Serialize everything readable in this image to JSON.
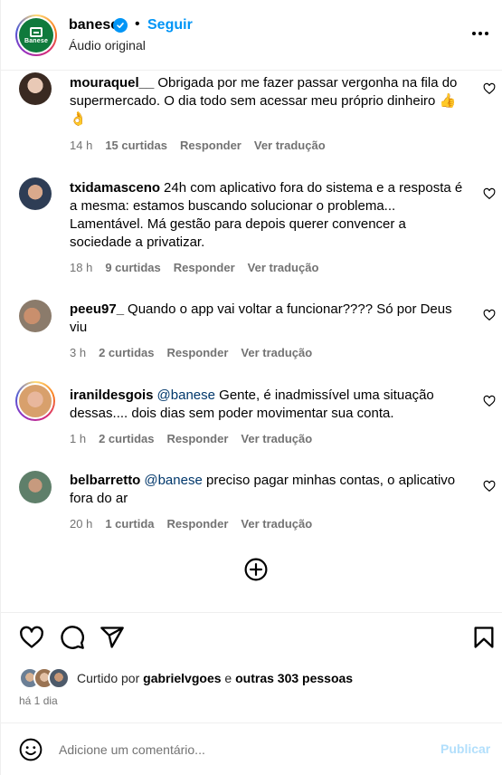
{
  "header": {
    "account": "banese",
    "logo_text": "Banese",
    "separator": "•",
    "follow_label": "Seguir",
    "audio_label": "Áudio original"
  },
  "comments": [
    {
      "username": "mouraquel__",
      "mention": "",
      "text": "Obrigada por me fazer passar vergonha na fila do supermercado. O dia todo sem acessar meu próprio dinheiro 👍 👌",
      "time": "14 h",
      "likes": "15 curtidas",
      "reply_label": "Responder",
      "translate_label": "Ver tradução"
    },
    {
      "username": "txidamasceno",
      "mention": "",
      "text": "24h com aplicativo fora do sistema e a resposta é a mesma: estamos buscando solucionar o problema... Lamentável. Má gestão para depois querer convencer a sociedade a privatizar.",
      "time": "18 h",
      "likes": "9 curtidas",
      "reply_label": "Responder",
      "translate_label": "Ver tradução"
    },
    {
      "username": "peeu97_",
      "mention": "",
      "text": "Quando o app vai voltar a funcionar???? Só por Deus viu",
      "time": "3 h",
      "likes": "2 curtidas",
      "reply_label": "Responder",
      "translate_label": "Ver tradução"
    },
    {
      "username": "iranildesgois",
      "mention": "@banese",
      "text": "Gente, é inadmissível uma situação dessas.... dois dias sem poder movimentar sua conta.",
      "time": "1 h",
      "likes": "2 curtidas",
      "reply_label": "Responder",
      "translate_label": "Ver tradução"
    },
    {
      "username": "belbarretto",
      "mention": "@banese",
      "text": "preciso pagar minhas contas, o aplicativo fora do ar",
      "time": "20 h",
      "likes": "1 curtida",
      "reply_label": "Responder",
      "translate_label": "Ver tradução"
    }
  ],
  "likes": {
    "prefix": "Curtido por",
    "user": "gabrielvgoes",
    "conjunction": "e",
    "others": "outras 303 pessoas"
  },
  "time_ago": "há 1 dia",
  "composer": {
    "placeholder": "Adicione um comentário...",
    "publish_label": "Publicar"
  },
  "icons": {
    "verified": "verified-badge-icon",
    "more": "more-options-icon",
    "like": "heart-icon",
    "comment": "comment-icon",
    "share": "share-icon",
    "save": "bookmark-icon",
    "load_more": "plus-circle-icon",
    "emoji": "emoji-icon"
  },
  "colors": {
    "accent": "#0095f6",
    "brand_green": "#0f7a3c",
    "secondary_text": "#737373",
    "mention": "#00376b",
    "publish_disabled": "#b2dffc"
  }
}
